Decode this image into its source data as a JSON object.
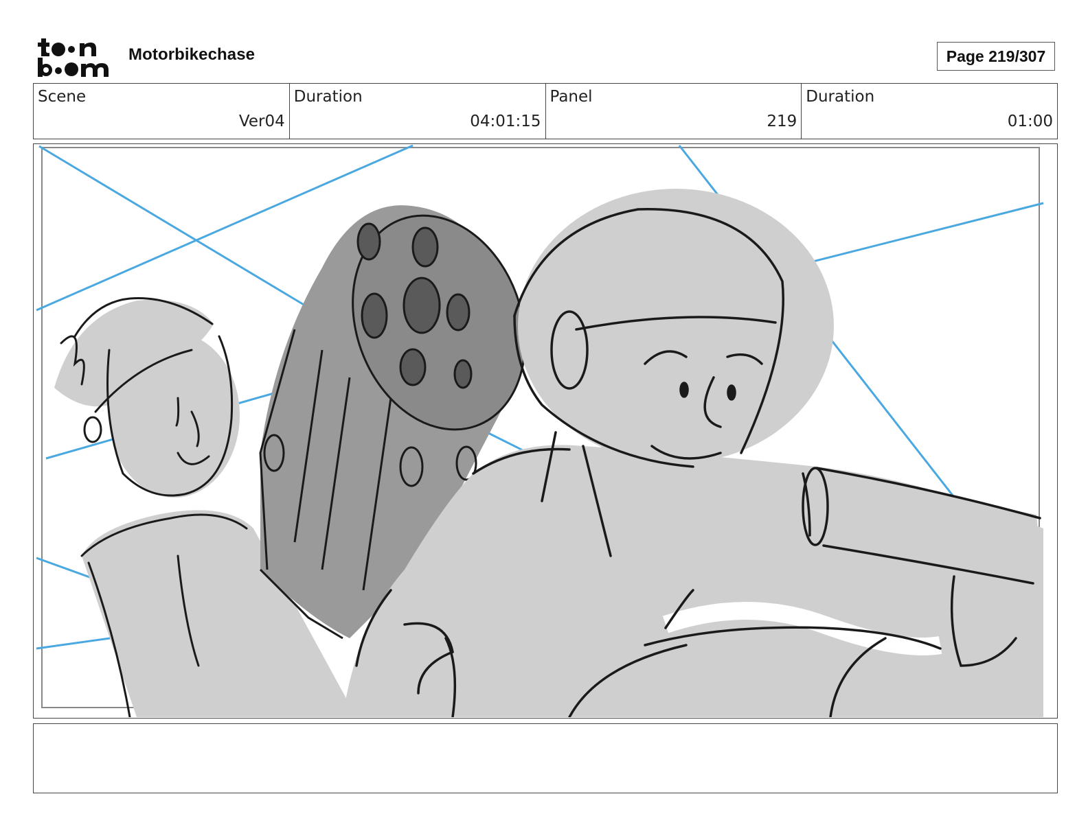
{
  "header": {
    "logo_text": "toon boom",
    "project_title": "Motorbikechase",
    "page_label": "Page 219/307"
  },
  "info": [
    {
      "label": "Scene",
      "value": "Ver04"
    },
    {
      "label": "Duration",
      "value": "04:01:15"
    },
    {
      "label": "Panel",
      "value": "219"
    },
    {
      "label": "Duration",
      "value": "01:00"
    }
  ],
  "panel": {
    "description": "",
    "colors": {
      "guide_lines": "#4aa8e0",
      "fill_light": "#cfcfcf",
      "fill_dark": "#9a9a9a",
      "ink": "#1a1a1a"
    }
  },
  "notes": {
    "text": ""
  }
}
